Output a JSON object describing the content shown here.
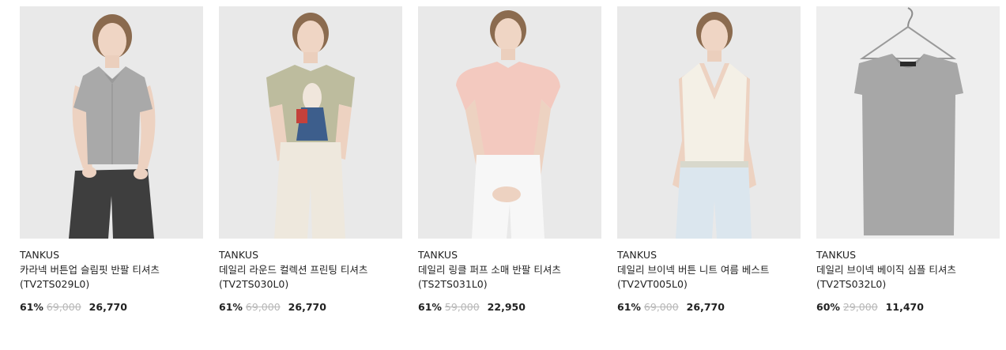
{
  "products": [
    {
      "brand": "TANKUS",
      "name": "카라넥 버튼업 슬림핏 반팔 티셔츠",
      "code": "(TV2TS029L0)",
      "discount": "61%",
      "original_price": "69,000",
      "price": "26,770",
      "image_icon": "model-gray-collar-top-photo"
    },
    {
      "brand": "TANKUS",
      "name": "데일리 라운드 컬렉션 프린팅 티셔츠",
      "code": "(TV2TS030L0)",
      "discount": "61%",
      "original_price": "69,000",
      "price": "26,770",
      "image_icon": "model-khaki-print-tee-photo"
    },
    {
      "brand": "TANKUS",
      "name": "데일리 링클 퍼프 소매 반팔 티셔츠",
      "code": "(TS2TS031L0)",
      "discount": "61%",
      "original_price": "59,000",
      "price": "22,950",
      "image_icon": "model-pink-puff-tee-photo"
    },
    {
      "brand": "TANKUS",
      "name": "데일리 브이넥 버튼 니트 여름 베스트",
      "code": "(TV2VT005L0)",
      "discount": "61%",
      "original_price": "69,000",
      "price": "26,770",
      "image_icon": "model-ivory-knit-vest-photo"
    },
    {
      "brand": "TANKUS",
      "name": "데일리 브이넥 베이직 심플 티셔츠",
      "code": "(TV2TS032L0)",
      "discount": "60%",
      "original_price": "29,000",
      "price": "11,470",
      "image_icon": "hanger-gray-vneck-tee-photo"
    }
  ],
  "colors": {
    "text": "#222222",
    "strike": "#b7b7b7",
    "image_bg": "#e8e8e8"
  }
}
